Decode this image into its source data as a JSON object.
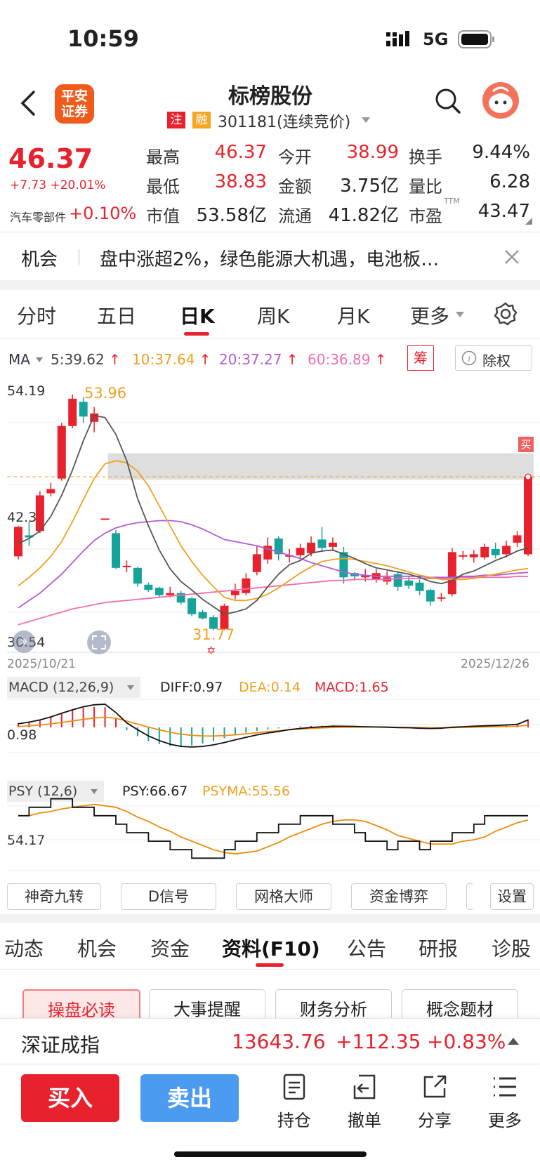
{
  "status_bar": {
    "time": "10:59",
    "network": "5G"
  },
  "header": {
    "brand": {
      "line1": "平安",
      "line2": "证券"
    },
    "title": "标榜股份",
    "tag_zhu": "注",
    "tag_rong": "融",
    "code": "301181(连续竞价)"
  },
  "quote": {
    "price": "46.37",
    "change": "+7.73 +20.01%",
    "sector_label": "汽车零部件",
    "sector_change": "+0.10%",
    "stats": [
      {
        "label": "最高",
        "value": "46.37"
      },
      {
        "label": "今开",
        "value": "38.99"
      },
      {
        "label": "换手",
        "value": "9.44%"
      },
      {
        "label": "最低",
        "value": "38.83"
      },
      {
        "label": "金额",
        "value": "3.75亿"
      },
      {
        "label": "量比",
        "value": "6.28"
      },
      {
        "label": "市值",
        "value": "53.58亿"
      },
      {
        "label": "流通",
        "value": "41.82亿"
      },
      {
        "label": "市盈",
        "value": "43.47"
      }
    ],
    "pe_sup": "TTM"
  },
  "news": {
    "tag": "机会",
    "text": "盘中涨超2%，绿色能源大机遇，电池板…"
  },
  "period_tabs": [
    "分时",
    "五日",
    "日K",
    "周K",
    "月K",
    "更多"
  ],
  "period_active": "日K",
  "ma_legend": {
    "label": "MA",
    "ma5": "5:39.62",
    "ma10": "10:37.64",
    "ma20": "20:37.27",
    "ma60": "60:36.89",
    "chip": "筹",
    "exright": "除权"
  },
  "colors": {
    "up": "#e8222d",
    "down": "#15a39a",
    "ma5": "#555555",
    "ma10": "#f0a020",
    "ma20": "#b05cd8",
    "ma60": "#f070b0",
    "zone": "#d8d8d8"
  },
  "kchart": {
    "y_top": "54.19",
    "y_mid": "42.3",
    "y_bot": "30.54",
    "max_label": "53.96",
    "min_label": "31.77",
    "date_start": "2025/10/21",
    "date_end": "2025/12/26",
    "buy_tag": "买"
  },
  "chart_data": {
    "type": "candlestick",
    "ylim": [
      30.54,
      54.19
    ],
    "candles": [
      {
        "o": 38.8,
        "c": 41.6,
        "h": 41.7,
        "l": 38.5
      },
      {
        "o": 40.8,
        "c": 40.6,
        "h": 42.1,
        "l": 39.8
      },
      {
        "o": 41.2,
        "c": 44.6,
        "h": 45.0,
        "l": 41.0
      },
      {
        "o": 44.8,
        "c": 45.2,
        "h": 45.8,
        "l": 44.5
      },
      {
        "o": 46.2,
        "c": 51.2,
        "h": 51.5,
        "l": 46.0
      },
      {
        "o": 51.2,
        "c": 53.8,
        "h": 54.19,
        "l": 51.0
      },
      {
        "o": 53.5,
        "c": 52.1,
        "h": 53.96,
        "l": 51.5
      },
      {
        "o": 51.6,
        "c": 52.4,
        "h": 53.0,
        "l": 50.6
      },
      {
        "o": 42.4,
        "c": 42.4,
        "h": 42.4,
        "l": 42.4
      },
      {
        "o": 41.0,
        "c": 37.7,
        "h": 41.3,
        "l": 37.6
      },
      {
        "o": 37.9,
        "c": 37.9,
        "h": 38.4,
        "l": 37.3
      },
      {
        "o": 37.7,
        "c": 36.2,
        "h": 37.8,
        "l": 35.9
      },
      {
        "o": 36.1,
        "c": 35.6,
        "h": 36.3,
        "l": 35.4
      },
      {
        "o": 35.8,
        "c": 35.1,
        "h": 35.9,
        "l": 34.9
      },
      {
        "o": 35.1,
        "c": 35.3,
        "h": 35.9,
        "l": 34.9
      },
      {
        "o": 35.3,
        "c": 34.4,
        "h": 35.5,
        "l": 34.2
      },
      {
        "o": 34.8,
        "c": 33.3,
        "h": 34.9,
        "l": 33.1
      },
      {
        "o": 33.5,
        "c": 32.9,
        "h": 33.7,
        "l": 32.8
      },
      {
        "o": 33.0,
        "c": 31.9,
        "h": 33.2,
        "l": 31.77
      },
      {
        "o": 31.9,
        "c": 34.1,
        "h": 34.3,
        "l": 31.8
      },
      {
        "o": 35.1,
        "c": 35.5,
        "h": 36.2,
        "l": 34.7
      },
      {
        "o": 35.3,
        "c": 36.7,
        "h": 37.2,
        "l": 35.1
      },
      {
        "o": 37.3,
        "c": 39.0,
        "h": 39.8,
        "l": 37.0
      },
      {
        "o": 38.5,
        "c": 39.8,
        "h": 40.6,
        "l": 38.1
      },
      {
        "o": 40.5,
        "c": 39.0,
        "h": 40.7,
        "l": 38.4
      },
      {
        "o": 38.8,
        "c": 38.9,
        "h": 39.5,
        "l": 38.2
      },
      {
        "o": 38.9,
        "c": 39.6,
        "h": 40.0,
        "l": 38.6
      },
      {
        "o": 39.1,
        "c": 40.1,
        "h": 40.7,
        "l": 38.8
      },
      {
        "o": 40.4,
        "c": 39.6,
        "h": 41.6,
        "l": 39.2
      },
      {
        "o": 39.7,
        "c": 40.1,
        "h": 40.6,
        "l": 39.3
      },
      {
        "o": 39.2,
        "c": 36.8,
        "h": 39.7,
        "l": 36.2
      },
      {
        "o": 37.2,
        "c": 36.9,
        "h": 37.3,
        "l": 36.5
      },
      {
        "o": 36.8,
        "c": 37.0,
        "h": 37.6,
        "l": 36.4
      },
      {
        "o": 36.6,
        "c": 37.2,
        "h": 37.6,
        "l": 36.3
      },
      {
        "o": 36.4,
        "c": 36.8,
        "h": 37.4,
        "l": 36.1
      },
      {
        "o": 37.1,
        "c": 35.9,
        "h": 37.4,
        "l": 35.5
      },
      {
        "o": 36.5,
        "c": 36.0,
        "h": 36.9,
        "l": 35.7
      },
      {
        "o": 36.3,
        "c": 35.5,
        "h": 36.6,
        "l": 35.1
      },
      {
        "o": 35.6,
        "c": 34.5,
        "h": 35.7,
        "l": 34.1
      },
      {
        "o": 34.9,
        "c": 34.9,
        "h": 35.3,
        "l": 34.5
      },
      {
        "o": 35.2,
        "c": 39.2,
        "h": 39.6,
        "l": 35.0
      },
      {
        "o": 38.9,
        "c": 38.9,
        "h": 39.3,
        "l": 38.5
      },
      {
        "o": 38.7,
        "c": 39.0,
        "h": 39.4,
        "l": 38.2
      },
      {
        "o": 38.7,
        "c": 39.7,
        "h": 40.0,
        "l": 38.5
      },
      {
        "o": 39.5,
        "c": 38.9,
        "h": 40.1,
        "l": 38.6
      },
      {
        "o": 39.0,
        "c": 39.8,
        "h": 40.3,
        "l": 38.7
      },
      {
        "o": 40.1,
        "c": 40.8,
        "h": 41.2,
        "l": 39.7
      },
      {
        "o": 38.99,
        "c": 46.37,
        "h": 46.37,
        "l": 38.83
      }
    ],
    "ma5": [
      40.0,
      40.5,
      41.2,
      42.6,
      44.6,
      47.0,
      49.8,
      52.2,
      52.0,
      50.4,
      47.9,
      44.3,
      41.7,
      39.4,
      37.6,
      36.4,
      35.6,
      34.7,
      34.0,
      33.3,
      33.5,
      33.8,
      34.6,
      35.9,
      37.1,
      38.0,
      38.4,
      39.1,
      39.3,
      39.4,
      39.0,
      38.6,
      38.1,
      37.7,
      37.5,
      37.3,
      37.1,
      36.8,
      36.4,
      36.2,
      36.5,
      37.1,
      37.4,
      37.9,
      38.4,
      38.8,
      39.3,
      39.62
    ],
    "ma10": [
      36.0,
      36.8,
      37.7,
      38.8,
      40.2,
      42.1,
      44.2,
      46.2,
      47.6,
      47.9,
      47.7,
      46.9,
      45.5,
      43.6,
      41.7,
      39.8,
      38.3,
      37.0,
      35.9,
      34.9,
      34.6,
      34.6,
      34.8,
      35.2,
      35.8,
      36.5,
      37.2,
      37.8,
      38.3,
      38.5,
      38.6,
      38.5,
      38.3,
      38.1,
      37.9,
      37.6,
      37.3,
      37.0,
      36.8,
      36.6,
      36.6,
      36.6,
      36.7,
      36.9,
      37.1,
      37.3,
      37.5,
      37.64
    ],
    "ma20": [
      33.9,
      34.6,
      35.3,
      36.2,
      37.1,
      38.2,
      39.3,
      40.3,
      41.0,
      41.5,
      41.8,
      42.0,
      42.1,
      42.2,
      42.2,
      42.1,
      41.8,
      41.4,
      40.9,
      40.4,
      40.2,
      40.0,
      39.8,
      39.5,
      39.2,
      38.9,
      38.6,
      38.2,
      37.9,
      37.6,
      37.3,
      37.1,
      37.0,
      36.9,
      36.9,
      36.9,
      36.9,
      36.9,
      36.8,
      36.8,
      36.8,
      36.9,
      36.9,
      37.0,
      37.0,
      37.1,
      37.2,
      37.27
    ],
    "ma60": [
      32.3,
      32.6,
      32.9,
      33.2,
      33.5,
      33.8,
      34.0,
      34.2,
      34.4,
      34.5,
      34.6,
      34.7,
      34.8,
      34.9,
      35.0,
      35.1,
      35.2,
      35.3,
      35.4,
      35.5,
      35.6,
      35.7,
      35.8,
      35.9,
      36.0,
      36.1,
      36.2,
      36.3,
      36.4,
      36.5,
      36.5,
      36.6,
      36.6,
      36.6,
      36.6,
      36.7,
      36.7,
      36.7,
      36.7,
      36.7,
      36.7,
      36.8,
      36.8,
      36.8,
      36.8,
      36.8,
      36.9,
      36.89
    ],
    "zone": {
      "top": 48.6,
      "bottom": 46.1
    },
    "macd_hist": [
      0.9,
      1.2,
      1.6,
      2.2,
      2.9,
      3.5,
      4.0,
      4.2,
      4.1,
      1.8,
      -0.6,
      -1.8,
      -2.8,
      -3.4,
      -3.8,
      -3.9,
      -3.7,
      -3.3,
      -2.8,
      -2.2,
      -1.6,
      -1.1,
      -0.7,
      -0.4,
      -0.2,
      0.1,
      0.2,
      0.3,
      0.35,
      0.4,
      0.3,
      0.2,
      0.1,
      0.05,
      0.0,
      -0.1,
      -0.1,
      -0.2,
      -0.25,
      -0.15,
      0.1,
      0.2,
      0.3,
      0.35,
      0.4,
      0.5,
      0.6,
      1.65
    ],
    "psy": [
      66.67,
      66.67,
      75,
      75,
      83.33,
      83.33,
      75,
      75,
      66.67,
      66.67,
      58.33,
      50,
      50,
      41.67,
      41.67,
      33.33,
      33.33,
      25,
      25,
      25,
      33.33,
      41.67,
      41.67,
      50,
      50,
      58.33,
      58.33,
      66.67,
      66.67,
      66.67,
      58.33,
      58.33,
      50,
      41.67,
      41.67,
      33.33,
      41.67,
      41.67,
      33.33,
      41.67,
      41.67,
      50,
      50,
      58.33,
      66.67,
      66.67,
      66.67,
      66.67
    ]
  },
  "macd": {
    "label": "MACD (12,26,9)",
    "diff": "DIFF:0.97",
    "dea": "DEA:0.14",
    "macd": "MACD:1.65",
    "y_label": "0.98"
  },
  "psy": {
    "label": "PSY (12,6)",
    "psy": "PSY:66.67",
    "psyma": "PSYMA:55.56",
    "y_label": "54.17"
  },
  "tools": [
    "神奇九转",
    "D信号",
    "网格大师",
    "资金博弈",
    "设置"
  ],
  "bottom_tabs": [
    "动态",
    "机会",
    "资金",
    "资料(F10)",
    "公告",
    "研报",
    "诊股"
  ],
  "bottom_tab_active": "资料(F10)",
  "f10_buttons": [
    "操盘必读",
    "大事提醒",
    "财务分析",
    "概念题材"
  ],
  "index_bar": {
    "name": "深证成指",
    "value": "13643.76",
    "change": "+112.35",
    "pct": "+0.83%"
  },
  "actions": {
    "buy": "买入",
    "sell": "卖出",
    "hold": "持仓",
    "cancel": "撤单",
    "share": "分享",
    "more": "更多"
  }
}
